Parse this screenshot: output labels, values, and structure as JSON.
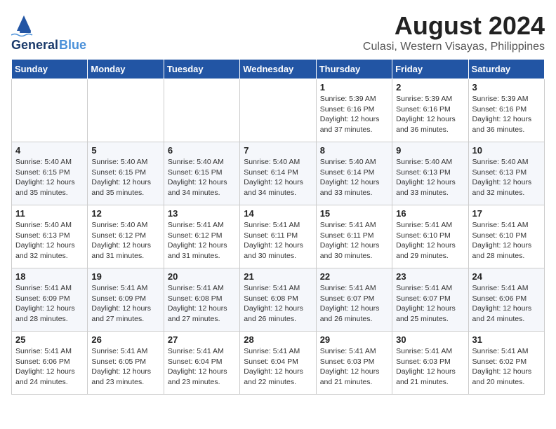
{
  "logo": {
    "line1": "General",
    "line2": "Blue",
    "icon_unicode": "⛵"
  },
  "title": "August 2024",
  "subtitle": "Culasi, Western Visayas, Philippines",
  "weekdays": [
    "Sunday",
    "Monday",
    "Tuesday",
    "Wednesday",
    "Thursday",
    "Friday",
    "Saturday"
  ],
  "weeks": [
    [
      {
        "day": "",
        "info": ""
      },
      {
        "day": "",
        "info": ""
      },
      {
        "day": "",
        "info": ""
      },
      {
        "day": "",
        "info": ""
      },
      {
        "day": "1",
        "info": "Sunrise: 5:39 AM\nSunset: 6:16 PM\nDaylight: 12 hours\nand 37 minutes."
      },
      {
        "day": "2",
        "info": "Sunrise: 5:39 AM\nSunset: 6:16 PM\nDaylight: 12 hours\nand 36 minutes."
      },
      {
        "day": "3",
        "info": "Sunrise: 5:39 AM\nSunset: 6:16 PM\nDaylight: 12 hours\nand 36 minutes."
      }
    ],
    [
      {
        "day": "4",
        "info": "Sunrise: 5:40 AM\nSunset: 6:15 PM\nDaylight: 12 hours\nand 35 minutes."
      },
      {
        "day": "5",
        "info": "Sunrise: 5:40 AM\nSunset: 6:15 PM\nDaylight: 12 hours\nand 35 minutes."
      },
      {
        "day": "6",
        "info": "Sunrise: 5:40 AM\nSunset: 6:15 PM\nDaylight: 12 hours\nand 34 minutes."
      },
      {
        "day": "7",
        "info": "Sunrise: 5:40 AM\nSunset: 6:14 PM\nDaylight: 12 hours\nand 34 minutes."
      },
      {
        "day": "8",
        "info": "Sunrise: 5:40 AM\nSunset: 6:14 PM\nDaylight: 12 hours\nand 33 minutes."
      },
      {
        "day": "9",
        "info": "Sunrise: 5:40 AM\nSunset: 6:13 PM\nDaylight: 12 hours\nand 33 minutes."
      },
      {
        "day": "10",
        "info": "Sunrise: 5:40 AM\nSunset: 6:13 PM\nDaylight: 12 hours\nand 32 minutes."
      }
    ],
    [
      {
        "day": "11",
        "info": "Sunrise: 5:40 AM\nSunset: 6:13 PM\nDaylight: 12 hours\nand 32 minutes."
      },
      {
        "day": "12",
        "info": "Sunrise: 5:40 AM\nSunset: 6:12 PM\nDaylight: 12 hours\nand 31 minutes."
      },
      {
        "day": "13",
        "info": "Sunrise: 5:41 AM\nSunset: 6:12 PM\nDaylight: 12 hours\nand 31 minutes."
      },
      {
        "day": "14",
        "info": "Sunrise: 5:41 AM\nSunset: 6:11 PM\nDaylight: 12 hours\nand 30 minutes."
      },
      {
        "day": "15",
        "info": "Sunrise: 5:41 AM\nSunset: 6:11 PM\nDaylight: 12 hours\nand 30 minutes."
      },
      {
        "day": "16",
        "info": "Sunrise: 5:41 AM\nSunset: 6:10 PM\nDaylight: 12 hours\nand 29 minutes."
      },
      {
        "day": "17",
        "info": "Sunrise: 5:41 AM\nSunset: 6:10 PM\nDaylight: 12 hours\nand 28 minutes."
      }
    ],
    [
      {
        "day": "18",
        "info": "Sunrise: 5:41 AM\nSunset: 6:09 PM\nDaylight: 12 hours\nand 28 minutes."
      },
      {
        "day": "19",
        "info": "Sunrise: 5:41 AM\nSunset: 6:09 PM\nDaylight: 12 hours\nand 27 minutes."
      },
      {
        "day": "20",
        "info": "Sunrise: 5:41 AM\nSunset: 6:08 PM\nDaylight: 12 hours\nand 27 minutes."
      },
      {
        "day": "21",
        "info": "Sunrise: 5:41 AM\nSunset: 6:08 PM\nDaylight: 12 hours\nand 26 minutes."
      },
      {
        "day": "22",
        "info": "Sunrise: 5:41 AM\nSunset: 6:07 PM\nDaylight: 12 hours\nand 26 minutes."
      },
      {
        "day": "23",
        "info": "Sunrise: 5:41 AM\nSunset: 6:07 PM\nDaylight: 12 hours\nand 25 minutes."
      },
      {
        "day": "24",
        "info": "Sunrise: 5:41 AM\nSunset: 6:06 PM\nDaylight: 12 hours\nand 24 minutes."
      }
    ],
    [
      {
        "day": "25",
        "info": "Sunrise: 5:41 AM\nSunset: 6:06 PM\nDaylight: 12 hours\nand 24 minutes."
      },
      {
        "day": "26",
        "info": "Sunrise: 5:41 AM\nSunset: 6:05 PM\nDaylight: 12 hours\nand 23 minutes."
      },
      {
        "day": "27",
        "info": "Sunrise: 5:41 AM\nSunset: 6:04 PM\nDaylight: 12 hours\nand 23 minutes."
      },
      {
        "day": "28",
        "info": "Sunrise: 5:41 AM\nSunset: 6:04 PM\nDaylight: 12 hours\nand 22 minutes."
      },
      {
        "day": "29",
        "info": "Sunrise: 5:41 AM\nSunset: 6:03 PM\nDaylight: 12 hours\nand 21 minutes."
      },
      {
        "day": "30",
        "info": "Sunrise: 5:41 AM\nSunset: 6:03 PM\nDaylight: 12 hours\nand 21 minutes."
      },
      {
        "day": "31",
        "info": "Sunrise: 5:41 AM\nSunset: 6:02 PM\nDaylight: 12 hours\nand 20 minutes."
      }
    ]
  ]
}
